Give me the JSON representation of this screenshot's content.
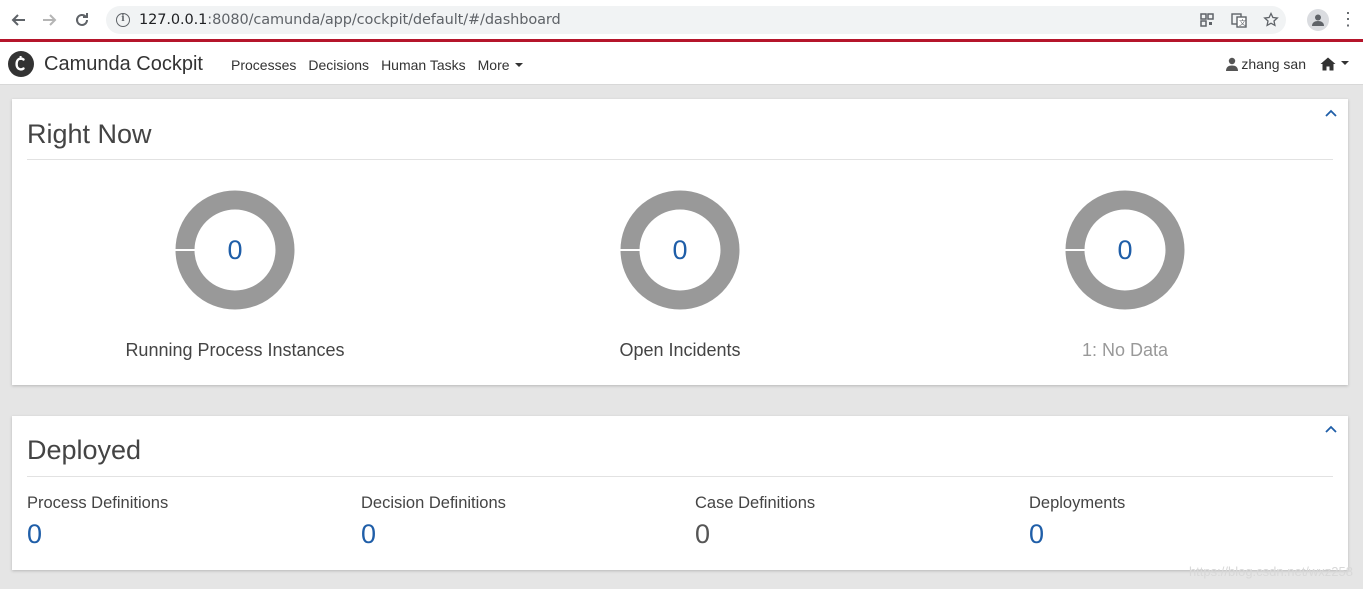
{
  "browser": {
    "url_host": "127.0.0.1",
    "url_rest": ":8080/camunda/app/cockpit/default/#/dashboard"
  },
  "app": {
    "brand": "Camunda Cockpit",
    "nav": [
      "Processes",
      "Decisions",
      "Human Tasks",
      "More"
    ],
    "user": "zhang san",
    "accent_color": "#b5152b",
    "link_color": "#1f5ea8"
  },
  "right_now": {
    "title": "Right Now",
    "metrics": [
      {
        "value": "0",
        "label": "Running Process Instances"
      },
      {
        "value": "0",
        "label": "Open Incidents"
      },
      {
        "value": "0",
        "label": "1: No Data"
      }
    ]
  },
  "deployed": {
    "title": "Deployed",
    "items": [
      {
        "label": "Process Definitions",
        "value": "0"
      },
      {
        "label": "Decision Definitions",
        "value": "0"
      },
      {
        "label": "Case Definitions",
        "value": "0"
      },
      {
        "label": "Deployments",
        "value": "0"
      }
    ]
  },
  "watermark": "https://blog.csdn.net/wxz258"
}
